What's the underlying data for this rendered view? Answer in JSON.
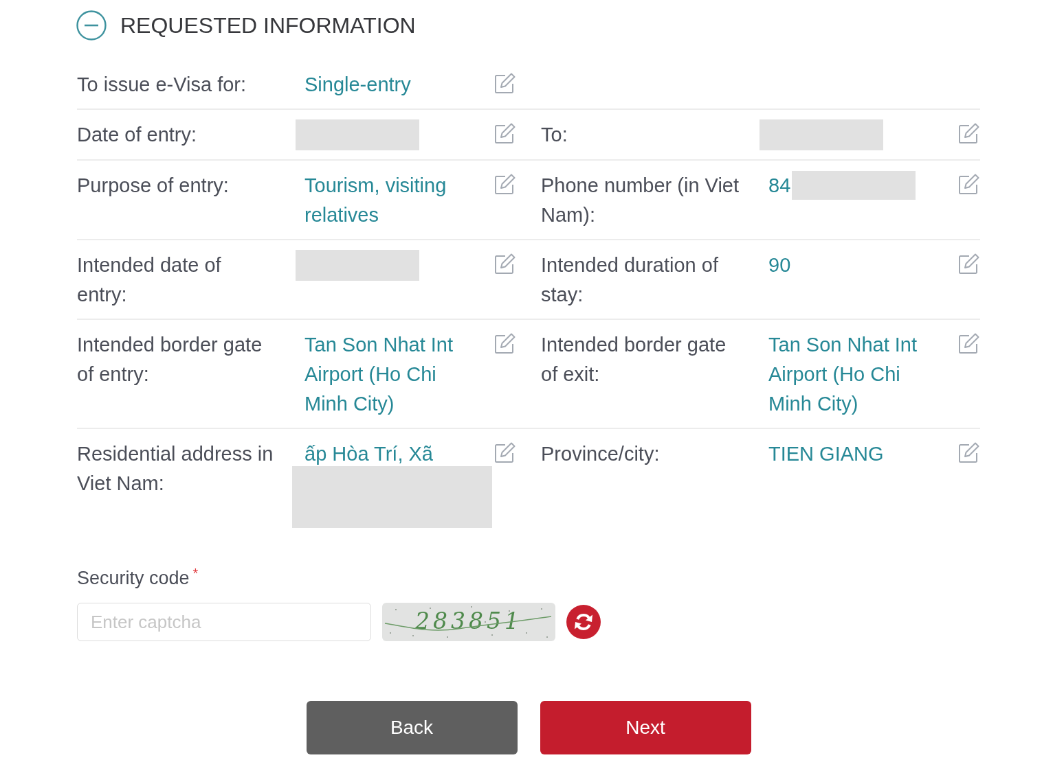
{
  "section": {
    "title": "REQUESTED INFORMATION",
    "expanded": true
  },
  "rows": [
    {
      "fields": [
        {
          "kind": "text",
          "label": "To issue e-Visa for:",
          "value": "Single-entry"
        }
      ]
    },
    {
      "fields": [
        {
          "kind": "text",
          "label": "Date of entry:",
          "redacted": true
        },
        {
          "kind": "text",
          "label": "To:",
          "redacted": true
        }
      ]
    },
    {
      "fields": [
        {
          "kind": "text",
          "label": "Purpose of entry:",
          "value": "Tourism, visiting relatives"
        },
        {
          "kind": "text",
          "label": "Phone number (in Viet Nam):",
          "value": "84",
          "redacted": true
        }
      ]
    },
    {
      "fields": [
        {
          "kind": "text",
          "label": "Intended date of entry:",
          "redacted": true
        },
        {
          "kind": "text",
          "label": "Intended duration of stay:",
          "value": "90"
        }
      ]
    },
    {
      "fields": [
        {
          "kind": "text",
          "label": "Intended border gate of entry:",
          "value": "Tan Son Nhat Int Airport (Ho Chi Minh City)"
        },
        {
          "kind": "text",
          "label": "Intended border gate of exit:",
          "value": "Tan Son Nhat Int Airport (Ho Chi Minh City)"
        }
      ]
    },
    {
      "fields": [
        {
          "kind": "address",
          "label": "Residential address in Viet Nam:",
          "value": "ấp Hòa Trí, Xã",
          "redacted": true
        },
        {
          "kind": "text",
          "label": "Province/city:",
          "value": "TIEN GIANG"
        }
      ]
    }
  ],
  "security_code": {
    "label": "Security code",
    "required_mark": "*",
    "placeholder": "Enter captcha",
    "captcha": "283851"
  },
  "buttons": [
    {
      "label": "Back",
      "kind": "secondary"
    },
    {
      "label": "Next",
      "kind": "primary"
    }
  ]
}
